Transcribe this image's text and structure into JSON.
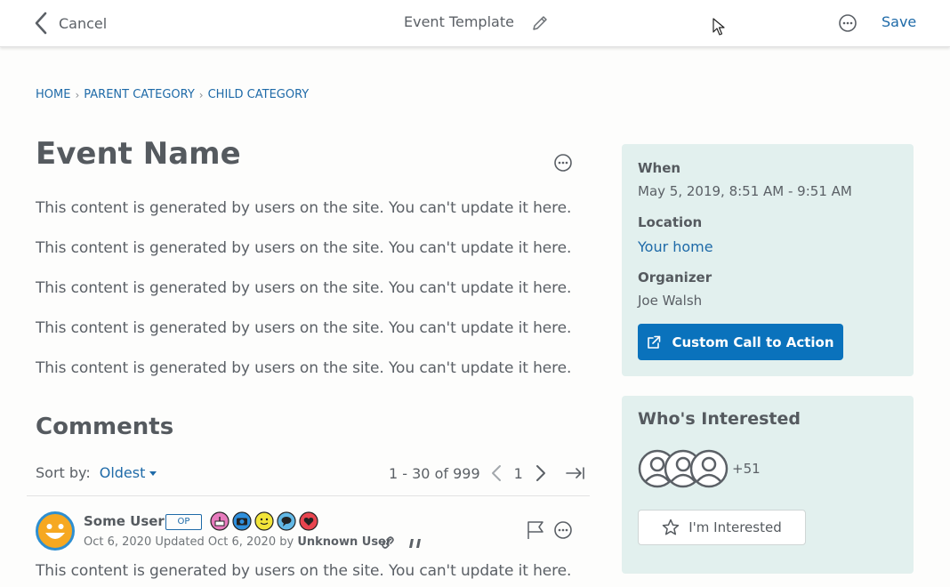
{
  "topbar": {
    "cancel_label": "Cancel",
    "title": "Event Template",
    "save_label": "Save"
  },
  "breadcrumb": {
    "items": [
      "HOME",
      "PARENT CATEGORY",
      "CHILD CATEGORY"
    ]
  },
  "event": {
    "title": "Event Name",
    "paragraphs": [
      "This content is generated by users on the site. You can't update it here.",
      "This content is generated by users on the site. You can't update it here.",
      "This content is generated by users on the site. You can't update it here.",
      "This content is generated by users on the site. You can't update it here.",
      "This content is generated by users on the site. You can't update it here."
    ]
  },
  "comments": {
    "heading": "Comments",
    "sort_label": "Sort by:",
    "sort_value": "Oldest",
    "pager": {
      "range": "1 - 30 of 999",
      "page": "1"
    },
    "items": [
      {
        "user": "Some User",
        "op_badge": "OP",
        "date": "Oct 6, 2020",
        "updated_prefix": "Updated",
        "updated_date": "Oct 6, 2020",
        "by_label": "by",
        "updated_by": "Unknown User",
        "body": "This content is generated by users on the site. You can't update it here.",
        "badges": [
          "birthday-cake-icon",
          "camera-icon",
          "smiley-icon",
          "speech-bubble-icon",
          "heart-icon"
        ]
      }
    ]
  },
  "details": {
    "when_label": "When",
    "when_value": "May 5, 2019, 8:51 AM - 9:51 AM",
    "location_label": "Location",
    "location_value": "Your home",
    "organizer_label": "Organizer",
    "organizer_value": "Joe Walsh",
    "cta_label": "Custom Call to Action"
  },
  "interested": {
    "heading": "Who's Interested",
    "more_count": "+51",
    "button_label": "I'm Interested"
  },
  "colors": {
    "link": "#1e6aa8",
    "cta": "#0a72bc",
    "panel": "#e2f0ee",
    "text": "#555a5f"
  }
}
